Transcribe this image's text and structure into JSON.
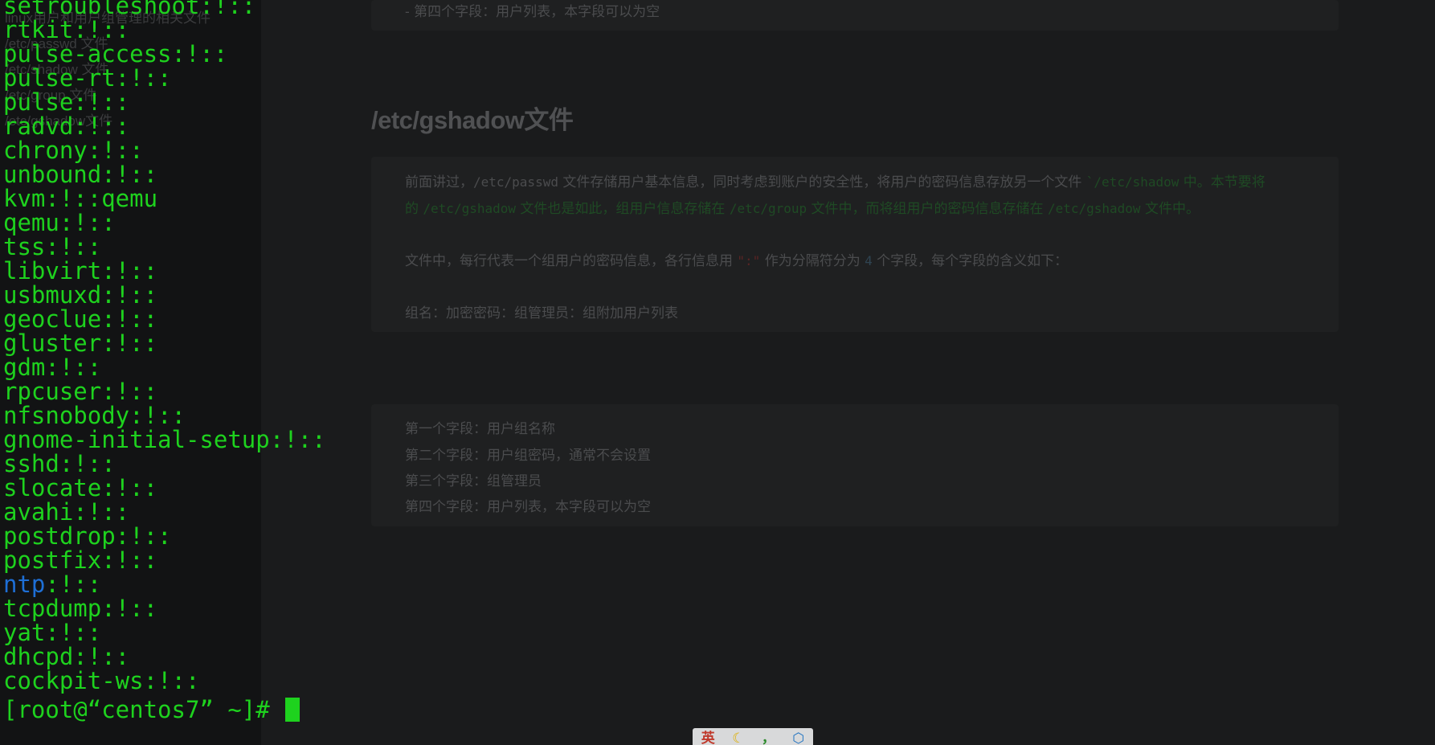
{
  "background_doc": {
    "toc_items": [
      "linux用户和用户组管理的相关文件",
      "/etc/passwd 文件",
      "/etc/shadow 文件",
      "/etc/group 文件",
      "/etc/gshadow文件"
    ],
    "top_line": "- 第四个字段：用户列表，本字段可以为空",
    "heading": "/etc/gshadow文件",
    "para1_a": "前面讲过，",
    "para1_code1": "/etc/passwd",
    "para1_b": " 文件存储用户基本信息，同时考虑到账户的安全性，将用户的密码信息存放另一个文件 ",
    "para1_code2": "`/etc/shadow",
    "para1_c": " 中。本节要将",
    "para2_a": "的 ",
    "para2_code1": "/etc/gshadow",
    "para2_b": " 文件也是如此，组用户信息存储在 ",
    "para2_code2": "/etc/group",
    "para2_c": " 文件中，而将组用户的密码信息存储在 ",
    "para2_code3": "/etc/gshadow",
    "para2_d": " 文件中。",
    "para3_a": "文件中，每行代表一个组用户的密码信息，各行信息用 ",
    "para3_sep": "\":\"",
    "para3_b": " 作为分隔符分为 ",
    "para3_num": "4",
    "para3_c": " 个字段，每个字段的含义如下：",
    "format_line": "组名：加密密码：组管理员：组附加用户列表",
    "fields": [
      "第一个字段：用户组名称",
      "第二个字段：用户组密码，通常不会设置",
      "第三个字段：组管理员",
      "第四个字段：用户列表，本字段可以为空"
    ]
  },
  "terminal": {
    "lines": [
      "setroubleshoot:!::",
      "rtkit:!::",
      "pulse-access:!::",
      "pulse-rt:!::",
      "pulse:!::",
      "radvd:!::",
      "chrony:!::",
      "unbound:!::",
      "kvm:!::qemu",
      "qemu:!::",
      "tss:!::",
      "libvirt:!::",
      "usbmuxd:!::",
      "geoclue:!::",
      "gluster:!::",
      "gdm:!::",
      "rpcuser:!::",
      "nfsnobody:!::",
      "gnome-initial-setup:!::",
      "sshd:!::",
      "slocate:!::",
      "avahi:!::",
      "postdrop:!::",
      "postfix:!::"
    ],
    "ntp_name": "ntp",
    "ntp_rest": ":!::",
    "lines_after": [
      "tcpdump:!::",
      "yat:!::",
      "dhcpd:!::",
      "cockpit-ws:!::"
    ],
    "prompt": "[root@“centos7” ~]# ",
    "text_color": "#1ed21e",
    "highlight_color": "#1e6fd6"
  },
  "ime_toolbar": {
    "lang": "英",
    "moon_icon": "moon-icon",
    "punct": "，",
    "gear_icon": "gear-icon"
  }
}
